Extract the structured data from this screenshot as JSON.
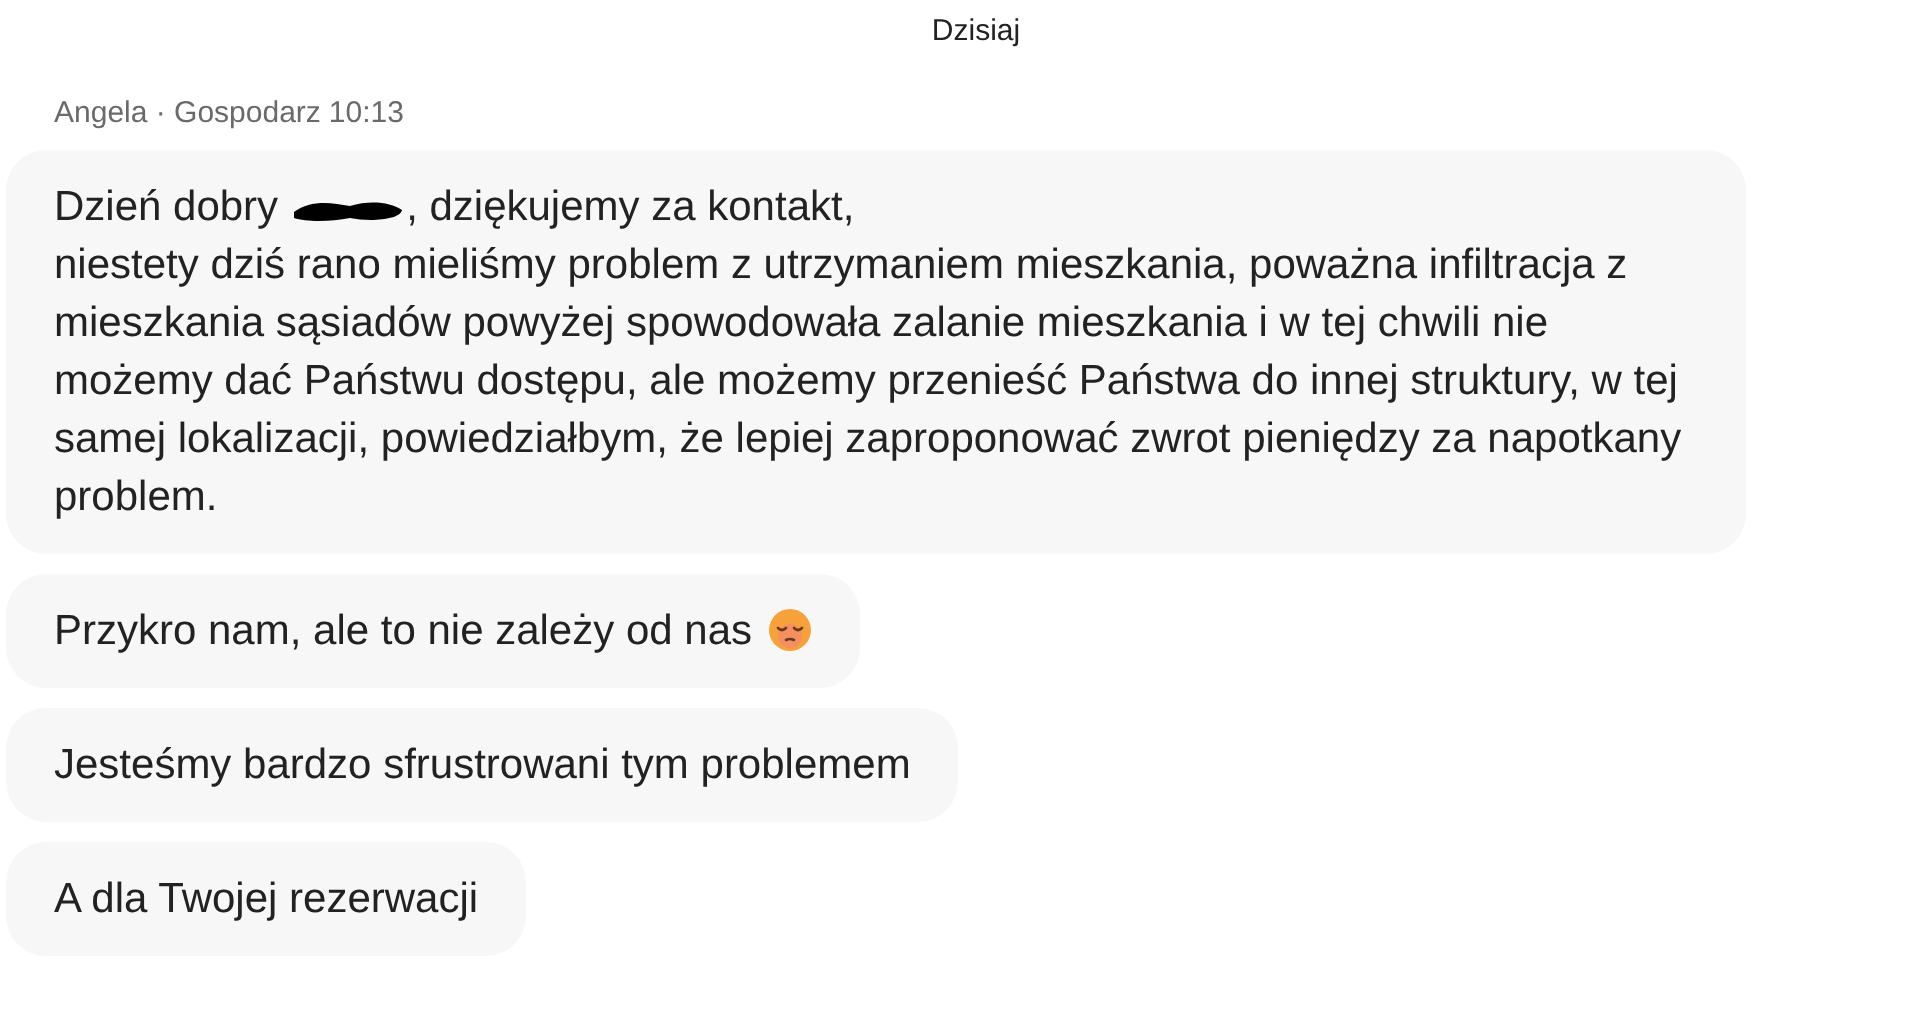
{
  "day_label": "Dzisiaj",
  "sender": {
    "name": "Angela · Gospodarz",
    "time": "10:13"
  },
  "messages": [
    {
      "kind": "redacted",
      "before": "Dzień dobry",
      "after": ", dziękujemy za kontakt,",
      "body": "niestety dziś rano mieliśmy problem z utrzymaniem mieszkania, poważna infiltracja z mieszkania sąsiadów powyżej spowodowała zalanie mieszkania i w tej chwili nie możemy dać Państwu dostępu, ale możemy przenieść Państwa do innej struktury, w tej samej lokalizacji, powiedziałbym, że lepiej zaproponować zwrot pieniędzy za napotkany problem."
    },
    {
      "kind": "emoji",
      "text": "Przykro nam, ale to nie zależy od nas"
    },
    {
      "kind": "plain",
      "text": "Jesteśmy bardzo sfrustrowani tym problemem"
    },
    {
      "kind": "plain",
      "text": "A dla Twojej rezerwacji"
    }
  ]
}
